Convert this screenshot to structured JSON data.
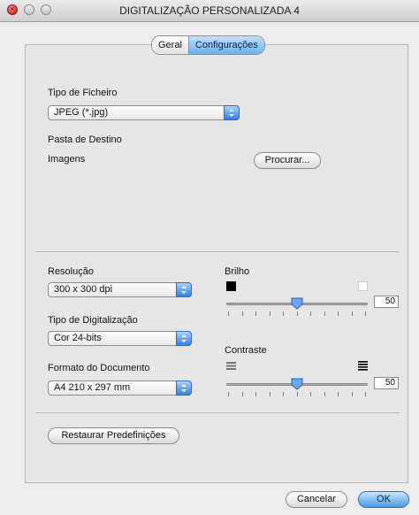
{
  "window": {
    "title": "DIGITALIZAÇÃO PERSONALIZADA 4"
  },
  "tabs": [
    {
      "label": "Geral",
      "active": false
    },
    {
      "label": "Configurações",
      "active": true
    }
  ],
  "file_type": {
    "label": "Tipo de Ficheiro",
    "value": "JPEG (*.jpg)"
  },
  "destination": {
    "label": "Pasta de Destino",
    "folder": "Imagens",
    "browse_label": "Procurar..."
  },
  "resolution": {
    "label": "Resolução",
    "value": "300 x 300 dpi"
  },
  "scan_type": {
    "label": "Tipo de Digitalização",
    "value": "Cor 24-bits"
  },
  "document_size": {
    "label": "Formato do Documento",
    "value": "A4 210 x 297 mm"
  },
  "brightness": {
    "label": "Brilho",
    "value": "50",
    "level": 0.5
  },
  "contrast": {
    "label": "Contraste",
    "value": "50",
    "level": 0.5
  },
  "restore_button": "Restaurar Predefinições",
  "cancel_button": "Cancelar",
  "ok_button": "OK",
  "colors": {
    "accent": "#4b9ae8",
    "close": "#d4271c"
  }
}
